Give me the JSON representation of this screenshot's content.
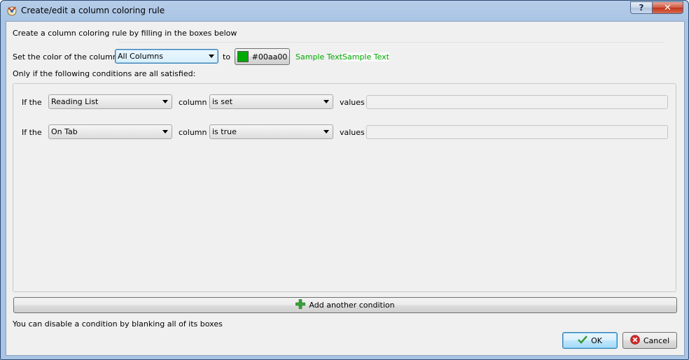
{
  "window": {
    "title": "Create/edit a column coloring rule",
    "help_label": "?",
    "close_label": "✕"
  },
  "intro": "Create a column coloring rule by filling in the boxes below",
  "color_row": {
    "label": "Set the  color  of the column:",
    "column_value": "All Columns",
    "to_label": "to",
    "color_button_label": "#00aa00",
    "color_hex": "#00aa00",
    "sample_text_1": "Sample Text",
    "sample_text_2": "Sample Text"
  },
  "conditions_label": "Only if the following conditions are all satisfied:",
  "conditions": [
    {
      "if_label": "If the",
      "column": "Reading List",
      "column_label": "column",
      "op": "is set",
      "values_label": "values",
      "value": ""
    },
    {
      "if_label": "If the",
      "column": "On Tab",
      "column_label": "column",
      "op": "is true",
      "values_label": "values",
      "value": ""
    }
  ],
  "add_condition_label": "Add another condition",
  "hint": "You can disable a condition by blanking all of its boxes",
  "buttons": {
    "ok": "OK",
    "cancel": "Cancel"
  },
  "icons": {
    "add": "plus-icon",
    "ok": "checkmark-icon",
    "cancel": "cancel-icon",
    "app": "calibre-icon"
  }
}
